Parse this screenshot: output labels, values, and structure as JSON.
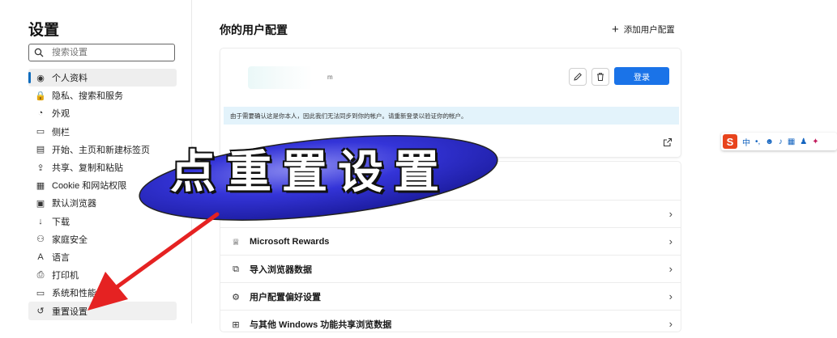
{
  "sidebar": {
    "title": "设置",
    "search_placeholder": "搜索设置",
    "items": [
      {
        "label": "个人资料",
        "icon": "profile-icon",
        "glyph": "◉"
      },
      {
        "label": "隐私、搜索和服务",
        "icon": "lock-icon",
        "glyph": "🔒"
      },
      {
        "label": "外观",
        "icon": "palette-icon",
        "glyph": "◔"
      },
      {
        "label": "侧栏",
        "icon": "sidebar-icon",
        "glyph": "▭"
      },
      {
        "label": "开始、主页和新建标签页",
        "icon": "home-tabs-icon",
        "glyph": "▤"
      },
      {
        "label": "共享、复制和粘贴",
        "icon": "share-icon",
        "glyph": "⇪"
      },
      {
        "label": "Cookie 和网站权限",
        "icon": "cookie-icon",
        "glyph": "▦"
      },
      {
        "label": "默认浏览器",
        "icon": "browser-icon",
        "glyph": "▣"
      },
      {
        "label": "下载",
        "icon": "download-icon",
        "glyph": "↓"
      },
      {
        "label": "家庭安全",
        "icon": "family-icon",
        "glyph": "⚇"
      },
      {
        "label": "语言",
        "icon": "language-icon",
        "glyph": "A"
      },
      {
        "label": "打印机",
        "icon": "printer-icon",
        "glyph": "⎙"
      },
      {
        "label": "系统和性能",
        "icon": "system-icon",
        "glyph": "▭"
      },
      {
        "label": "重置设置",
        "icon": "reset-icon",
        "glyph": "↺"
      }
    ]
  },
  "main": {
    "title": "你的用户配置",
    "add_profile": "添加用户配置",
    "account_suffix": "m",
    "login_label": "登录",
    "info_text": "由于需要确认这是你本人，因此我们无法同步到你的帐户。请重新登录以验证你的帐户。",
    "rows": [
      {
        "label": "Microsoft Rewards",
        "icon": "rewards-icon",
        "glyph": "♕"
      },
      {
        "label": "导入浏览器数据",
        "icon": "import-icon",
        "glyph": "⧉"
      },
      {
        "label": "用户配置偏好设置",
        "icon": "profile-prefs-icon",
        "glyph": "⚙"
      },
      {
        "label": "与其他 Windows 功能共享浏览数据",
        "icon": "windows-icon",
        "glyph": "⊞"
      }
    ]
  },
  "ime": {
    "logo": "S",
    "mode": "中"
  },
  "overlay": {
    "text": "点重置设置"
  },
  "colors": {
    "accent": "#0f6cbd",
    "login": "#1a73e8",
    "info_bg": "#e3f3fb",
    "ellipse": "#3b3bd8",
    "arrow": "#e52222"
  }
}
